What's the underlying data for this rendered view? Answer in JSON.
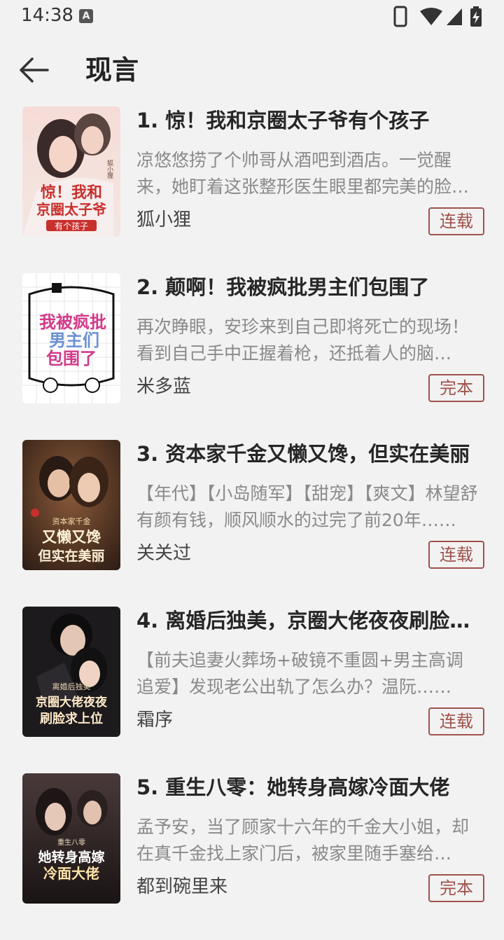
{
  "status_bar": {
    "time": "14:38",
    "notification_icon": "a-icon",
    "icons": [
      "phone-icon",
      "wifi-icon",
      "cell-signal-icon",
      "battery-charging-icon"
    ]
  },
  "header": {
    "back_icon": "arrow-left-icon",
    "title": "现言"
  },
  "colors": {
    "background": "#f2f2f2",
    "tag_accent": "#a0524b",
    "desc_text": "#8a8a8a"
  },
  "books": [
    {
      "title": "1. 惊！我和京圈太子爷有个孩子",
      "description": "凉悠悠捞了个帅哥从酒吧到酒店。一觉醒来，她盯着这张整形医生眼里都完美的脸，心里只剩下一个念头……",
      "author": "狐小狸",
      "status": "连载",
      "cover": {
        "title_lines": [
          "惊！我和",
          "京圈太子爷"
        ],
        "sub": "有个孩子",
        "author_mark": "狐小狸"
      }
    },
    {
      "title": "2. 颠啊！我被疯批男主们包围了",
      "description": "再次睁眼，安珍来到自己即将死亡的现场！看到自己手中正握着枪，还抵着人的脑袋……",
      "author": "米多蓝",
      "status": "完本",
      "cover": {
        "title_lines": [
          "我被疯批",
          "男主们",
          "包围了"
        ],
        "sub": "",
        "author_mark": ""
      }
    },
    {
      "title": "3. 资本家千金又懒又馋，但实在美丽",
      "description": "【年代】【小岛随军】【甜宠】【爽文】林望舒有颜有钱，顺风顺水的过完了前20年……",
      "author": "关关过",
      "status": "连载",
      "cover": {
        "title_lines": [
          "又懒又馋",
          "但实在美丽"
        ],
        "sub": "资本家千金",
        "author_mark": ""
      }
    },
    {
      "title": "4. 离婚后独美，京圈大佬夜夜刷脸求上位",
      "description": "【前夫追妻火葬场+破镜不重圆+男主高调追爱】发现老公出轨了怎么办？温阮……",
      "author": "霜序",
      "status": "连载",
      "cover": {
        "title_lines": [
          "京圈大佬夜夜",
          "刷脸求上位"
        ],
        "sub": "离婚后独美",
        "author_mark": ""
      }
    },
    {
      "title": "5. 重生八零：她转身高嫁冷面大佬",
      "description": "孟予安，当了顾家十六年的千金大小姐，却在真千金找上家门后，被家里随手塞给了……",
      "author": "都到碗里来",
      "status": "完本",
      "cover": {
        "title_lines": [
          "她转身高嫁",
          "冷面大佬"
        ],
        "sub": "重生八零",
        "author_mark": ""
      }
    }
  ]
}
